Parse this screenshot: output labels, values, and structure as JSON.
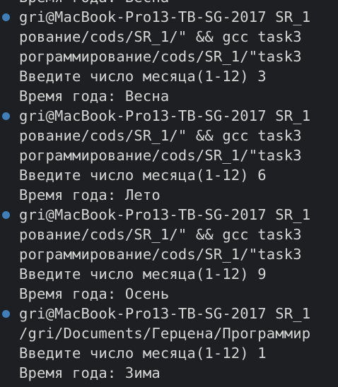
{
  "terminal": {
    "accent_color": "#3e7fb8",
    "lines": [
      {
        "text": "Время года: Весна",
        "marker": false
      },
      {
        "text": "gri@MacBook-Pro13-TB-SG-2017 SR_1",
        "marker": true
      },
      {
        "text": "рование/cods/SR_1/\" && gcc task3",
        "marker": false
      },
      {
        "text": "рограммирование/cods/SR_1/\"task3",
        "marker": false
      },
      {
        "text": "Введите число месяца(1-12) 3",
        "marker": false
      },
      {
        "text": "Время года: Весна",
        "marker": false
      },
      {
        "text": "gri@MacBook-Pro13-TB-SG-2017 SR_1",
        "marker": true
      },
      {
        "text": "рование/cods/SR_1/\" && gcc task3",
        "marker": false
      },
      {
        "text": "рограммирование/cods/SR_1/\"task3",
        "marker": false
      },
      {
        "text": "Введите число месяца(1-12) 6",
        "marker": false
      },
      {
        "text": "Время года: Лето",
        "marker": false
      },
      {
        "text": "gri@MacBook-Pro13-TB-SG-2017 SR_1",
        "marker": true
      },
      {
        "text": "рование/cods/SR_1/\" && gcc task3",
        "marker": false
      },
      {
        "text": "рограммирование/cods/SR_1/\"task3",
        "marker": false
      },
      {
        "text": "Введите число месяца(1-12) 9",
        "marker": false
      },
      {
        "text": "Время года: Осень",
        "marker": false
      },
      {
        "text": "gri@MacBook-Pro13-TB-SG-2017 SR_1",
        "marker": true
      },
      {
        "text": "/gri/Documents/Герцена/Программир",
        "marker": false
      },
      {
        "text": "Введите число месяца(1-12) 1",
        "marker": false
      },
      {
        "text": "Время года: Зима",
        "marker": false
      }
    ]
  }
}
